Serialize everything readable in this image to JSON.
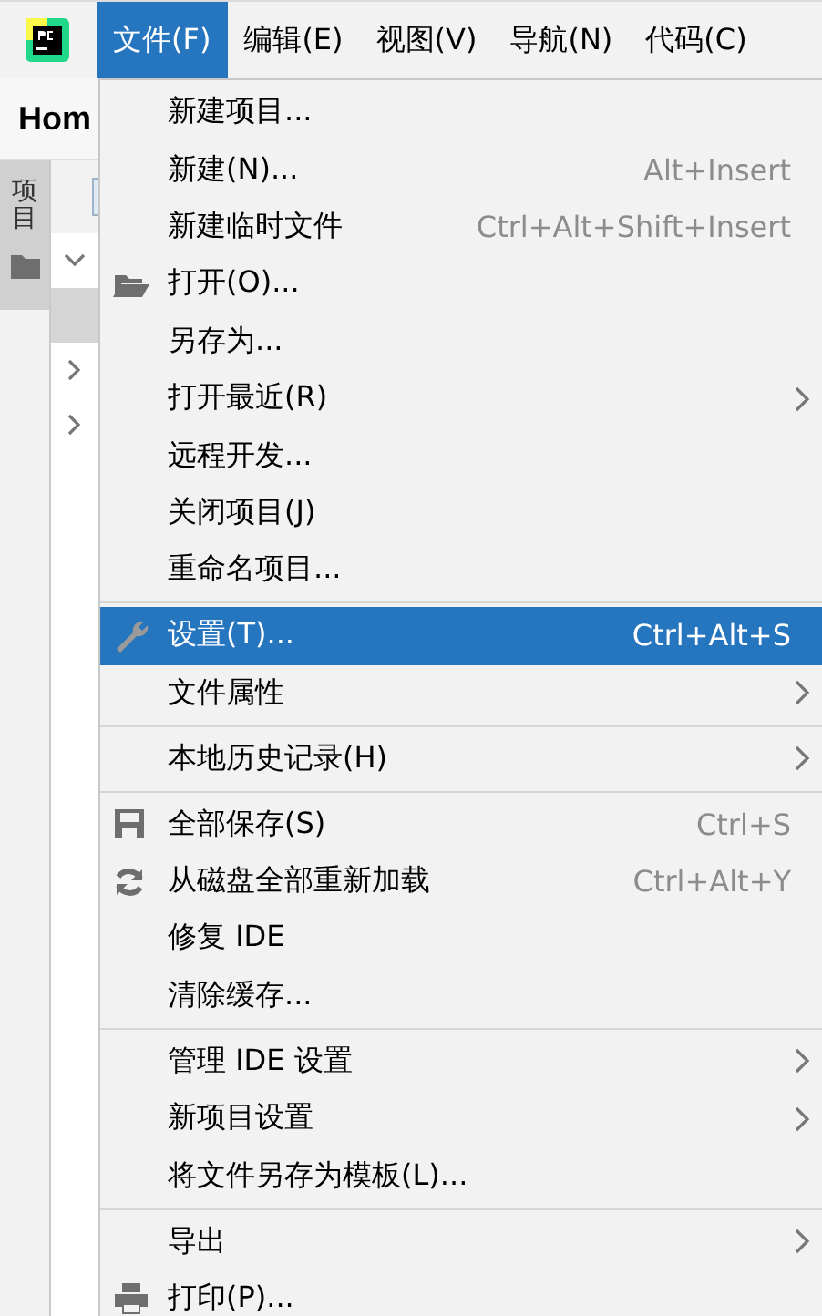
{
  "menubar": [
    {
      "label": "文件(F)",
      "selected": true
    },
    {
      "label": "编辑(E)",
      "selected": false
    },
    {
      "label": "视图(V)",
      "selected": false
    },
    {
      "label": "导航(N)",
      "selected": false
    },
    {
      "label": "代码(C)",
      "selected": false
    }
  ],
  "tab_title": "Hom",
  "tool_window": {
    "label": "项目",
    "selected": true
  },
  "tree": [
    {
      "kind": "folder",
      "expanded": true,
      "selected": false
    },
    {
      "kind": "blank",
      "selected": true
    },
    {
      "kind": "folder",
      "expanded": false,
      "selected": false
    },
    {
      "kind": "folder",
      "expanded": false,
      "selected": false
    }
  ],
  "menu": {
    "groups": [
      [
        {
          "label": "新建项目...",
          "kind": "plain",
          "selected": false
        },
        {
          "label": "新建(N)...",
          "kind": "plain",
          "shortcut": "Alt+Insert",
          "selected": false
        },
        {
          "label": "新建临时文件",
          "kind": "plain",
          "shortcut": "Ctrl+Alt+Shift+Insert",
          "selected": false
        },
        {
          "label": "打开(O)...",
          "kind": "open",
          "selected": false
        },
        {
          "label": "另存为...",
          "kind": "plain",
          "selected": false
        },
        {
          "label": "打开最近(R)",
          "kind": "plain",
          "submenu": true,
          "selected": false
        },
        {
          "label": "远程开发...",
          "kind": "plain",
          "selected": false
        },
        {
          "label": "关闭项目(J)",
          "kind": "plain",
          "selected": false
        },
        {
          "label": "重命名项目...",
          "kind": "plain",
          "selected": false
        }
      ],
      [
        {
          "label": "设置(T)...",
          "kind": "settings",
          "shortcut": "Ctrl+Alt+S",
          "selected": true
        },
        {
          "label": "文件属性",
          "kind": "plain",
          "submenu": true,
          "selected": false
        }
      ],
      [
        {
          "label": "本地历史记录(H)",
          "kind": "plain",
          "submenu": true,
          "selected": false
        }
      ],
      [
        {
          "label": "全部保存(S)",
          "kind": "save",
          "shortcut": "Ctrl+S",
          "selected": false
        },
        {
          "label": "从磁盘全部重新加载",
          "kind": "reload",
          "shortcut": "Ctrl+Alt+Y",
          "selected": false
        },
        {
          "label": "修复 IDE",
          "kind": "plain",
          "selected": false
        },
        {
          "label": "清除缓存...",
          "kind": "plain",
          "selected": false
        }
      ],
      [
        {
          "label": "管理 IDE 设置",
          "kind": "plain",
          "submenu": true,
          "selected": false
        },
        {
          "label": "新项目设置",
          "kind": "plain",
          "submenu": true,
          "selected": false
        },
        {
          "label": "将文件另存为模板(L)...",
          "kind": "plain",
          "selected": false
        }
      ],
      [
        {
          "label": "导出",
          "kind": "plain",
          "submenu": true,
          "selected": false
        },
        {
          "label": "打印(P)...",
          "kind": "print",
          "selected": false
        }
      ]
    ]
  }
}
